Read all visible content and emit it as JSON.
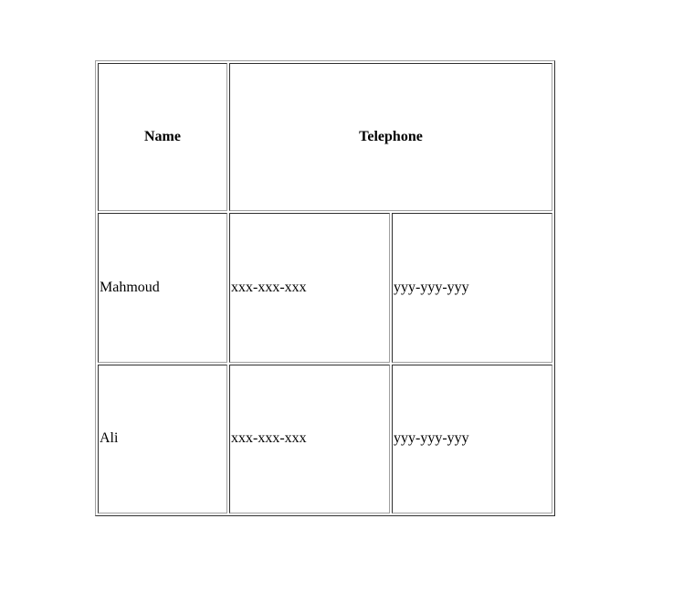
{
  "table": {
    "headers": {
      "name": "Name",
      "telephone": "Telephone"
    },
    "rows": [
      {
        "name": "Mahmoud",
        "phone1": "xxx-xxx-xxx",
        "phone2": "yyy-yyy-yyy"
      },
      {
        "name": "Ali",
        "phone1": "xxx-xxx-xxx",
        "phone2": "yyy-yyy-yyy"
      }
    ]
  }
}
